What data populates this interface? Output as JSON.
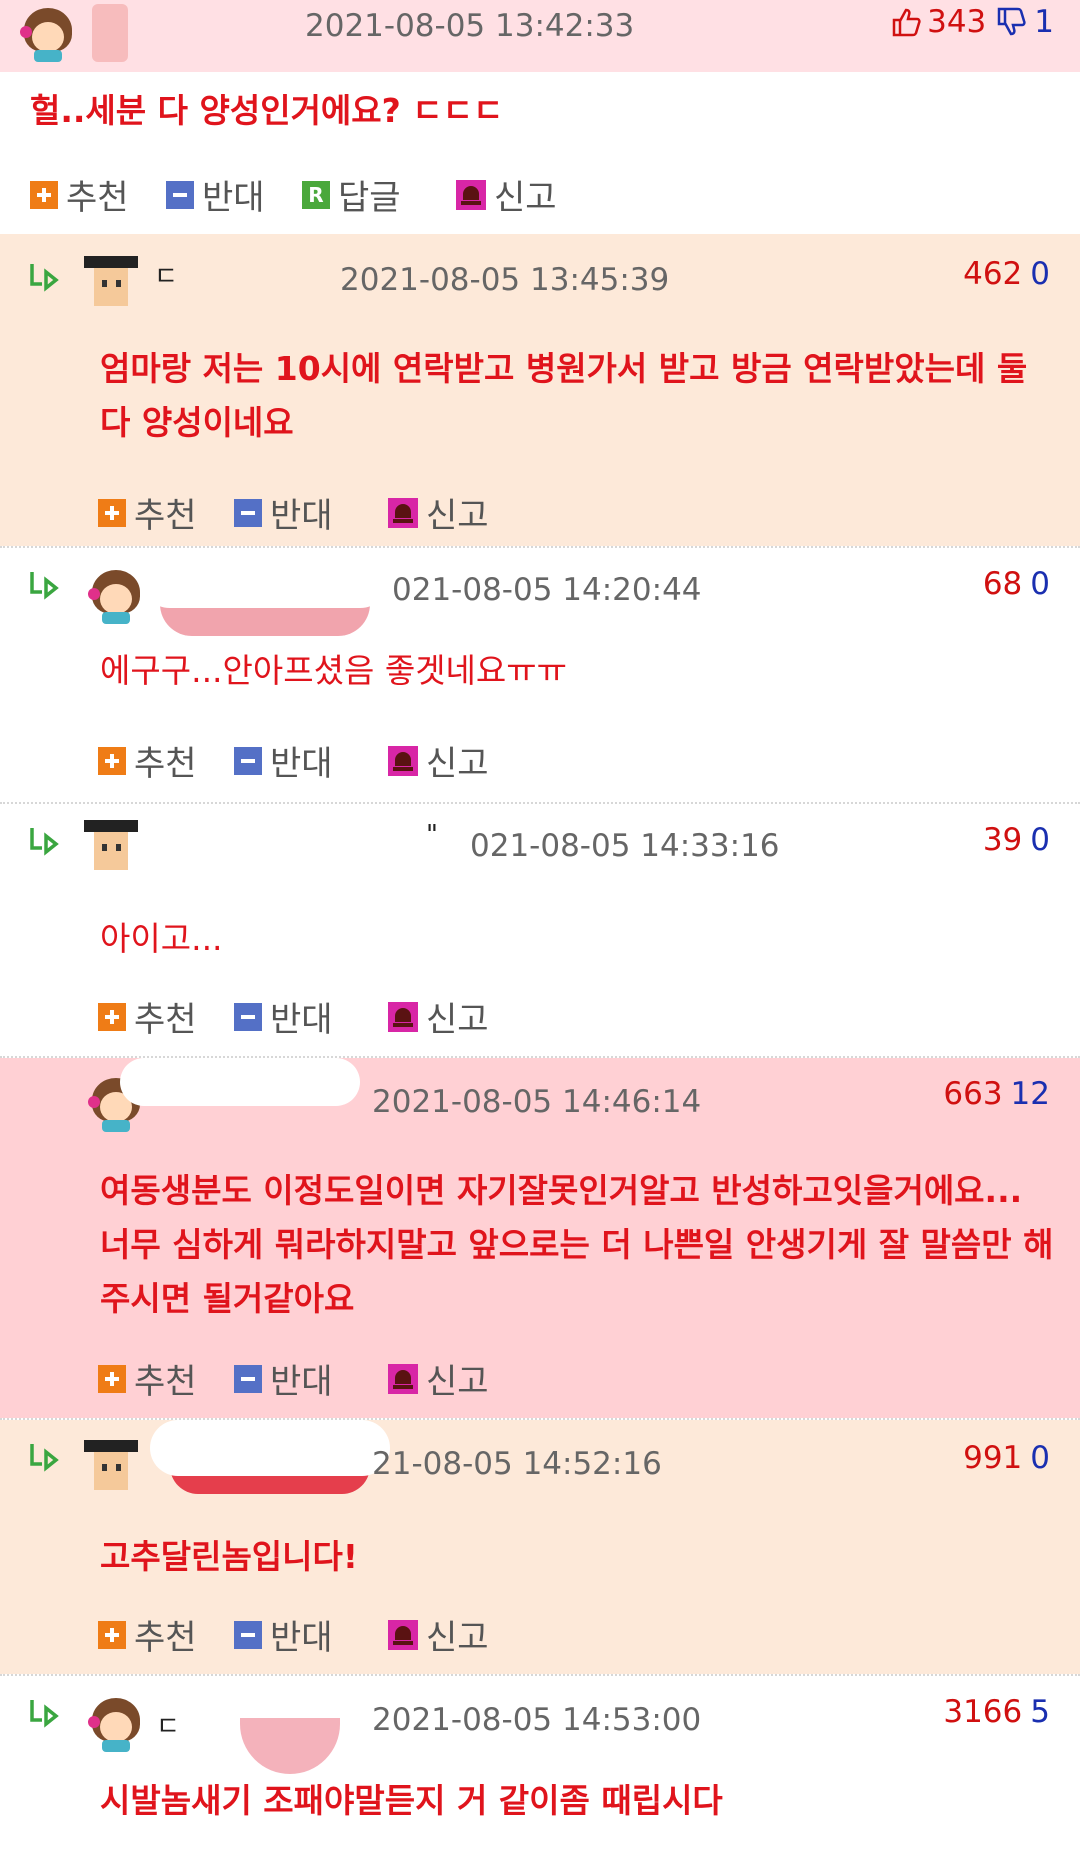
{
  "header": {
    "timestamp": "2021-08-05 13:42:33",
    "likes": "343",
    "dislikes": "1"
  },
  "main_post": {
    "text": "헐..세분 다 양성인거에요? ㄷㄷㄷ"
  },
  "actions": {
    "recommend": "추천",
    "oppose": "반대",
    "reply": "답글",
    "report": "신고",
    "reply_badge": "R"
  },
  "comments": [
    {
      "name_mark": "ㄷ",
      "timestamp": "2021-08-05 13:45:39",
      "up": "462",
      "down": "0",
      "text": "엄마랑 저는 10시에 연락받고 병원가서 받고 방금 연락받았는데 둘 다 양성이네요",
      "bg": "#fde9d9"
    },
    {
      "name_mark": "",
      "timestamp": "021-08-05 14:20:44",
      "up": "68",
      "down": "0",
      "text": "에구구...안아프셨음 좋겟네요ㅠㅠ",
      "bg": "#ffffff"
    },
    {
      "name_mark": "\"",
      "timestamp": "021-08-05 14:33:16",
      "up": "39",
      "down": "0",
      "text": "아이고...",
      "bg": "#ffffff"
    },
    {
      "name_mark": "",
      "timestamp": "2021-08-05 14:46:14",
      "up": "663",
      "down": "12",
      "text": "여동생분도 이정도일이면 자기잘못인거알고 반성하고잇을거에요... 너무 심하게 뭐라하지말고 앞으로는 더 나쁜일 안생기게 잘 말씀만 해주시면 될거같아요",
      "bg": "#ffd0d4"
    },
    {
      "name_mark": "",
      "timestamp": "21-08-05 14:52:16",
      "up": "991",
      "down": "0",
      "text": "고추달린놈입니다!",
      "bg": "#fde9d9"
    },
    {
      "name_mark": "ㄷ",
      "timestamp": "2021-08-05 14:53:00",
      "up": "3166",
      "down": "5",
      "text": "시발놈새기 조패야말듣지 거 같이좀 때립시다",
      "bg": "#ffffff"
    }
  ],
  "colors": {
    "accent_red": "#e0141c",
    "vote_up": "#d01010",
    "vote_down": "#1a2fb0",
    "header_bg": "#ffe0e4"
  }
}
